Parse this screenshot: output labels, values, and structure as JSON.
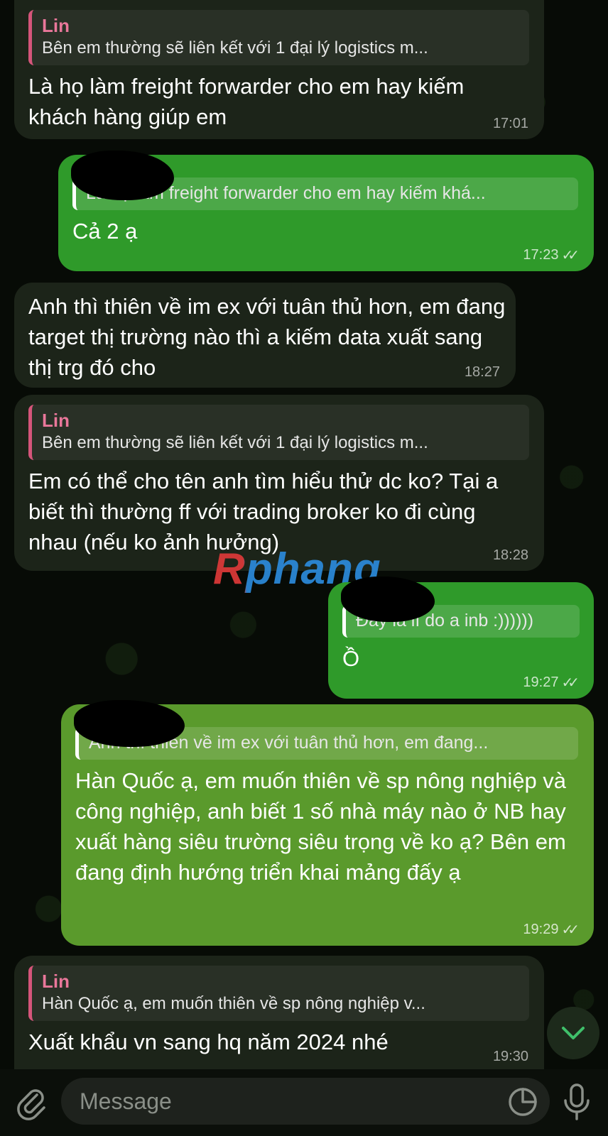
{
  "watermark": "Rphang",
  "messages": [
    {
      "quote_name": "Lin",
      "quote_text": "Bên em thường sẽ liên kết với 1 đại lý logistics m...",
      "text": "Là họ làm freight forwarder cho em hay kiếm khách hàng giúp em",
      "time": "17:01"
    },
    {
      "quote_text": "Là họ làm freight forwarder cho em hay kiếm khá...",
      "text": "Cả 2 ạ",
      "time": "17:23"
    },
    {
      "text": "Anh thì thiên về im ex với tuân thủ hơn, em đang target thị trường nào thì a kiếm data xuất sang thị trg đó cho",
      "time": "18:27"
    },
    {
      "quote_name": "Lin",
      "quote_text": "Bên em thường sẽ liên kết với 1 đại lý logistics m...",
      "text": "Em có thể cho tên anh tìm hiểu thử dc ko? Tại a biết thì thường ff với trading broker ko đi cùng nhau (nếu ko ảnh hưởng)",
      "time": "18:28"
    },
    {
      "quote_text": "Đây là lí do a inb :))))))",
      "text": "Ồ",
      "time": "19:27"
    },
    {
      "quote_text": "Anh thì thiên về im ex với tuân thủ hơn, em đang...",
      "text": "Hàn Quốc ạ, em muốn thiên về sp nông nghiệp và công nghiệp, anh biết 1 số nhà máy nào ở NB hay xuất hàng siêu trường siêu trọng về ko ạ? Bên em đang định hướng triển khai mảng đấy ạ",
      "time": "19:29"
    },
    {
      "quote_name": "Lin",
      "quote_text": "Hàn Quốc ạ, em muốn thiên về sp nông nghiệp v...",
      "text": "Xuất khẩu vn sang hq năm 2024 nhé",
      "time": "19:30"
    }
  ],
  "composer": {
    "placeholder": "Message"
  },
  "icons": {
    "attach": "paperclip-icon",
    "sticker": "sticker-icon",
    "mic": "microphone-icon",
    "scroll": "chevron-down-icon",
    "read": "double-check-icon"
  },
  "colors": {
    "incoming_bubble": "#1c2419",
    "outgoing_bubble": "#2f9a2a",
    "outgoing_bubble_alt": "#5a9a2c",
    "quote_accent": "#d5557a",
    "quote_name": "#e9779a"
  }
}
